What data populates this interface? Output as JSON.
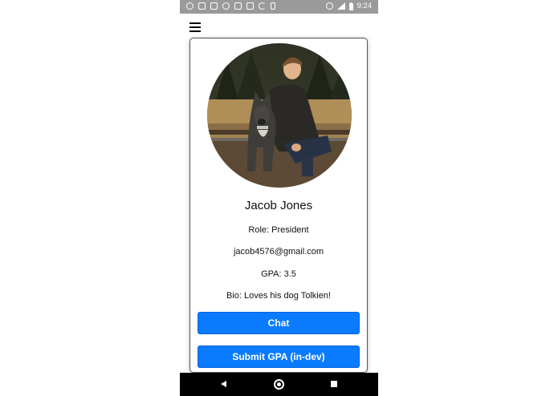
{
  "status_bar": {
    "time": "9:24",
    "left_icons": [
      "a-icon",
      "twitch-icon",
      "gmail-icon",
      "chrome-icon",
      "instagram-icon",
      "news-icon",
      "refresh-icon",
      "phone-icon"
    ],
    "right_icons": [
      "do-not-disturb-icon",
      "signal-icon",
      "battery-icon"
    ]
  },
  "header": {
    "menu_icon": "hamburger-menu-icon"
  },
  "profile": {
    "name": "Jacob Jones",
    "role": "Role: President",
    "email": "jacob4576@gmail.com",
    "gpa": "GPA: 3.5",
    "bio": "Bio: Loves his dog Tolkien!"
  },
  "buttons": {
    "chat": "Chat",
    "submit_gpa": "Submit GPA (in-dev)"
  },
  "colors": {
    "button_blue": "#0a7bff",
    "status_bar": "#9a9a9a",
    "nav_bar": "#000000"
  }
}
